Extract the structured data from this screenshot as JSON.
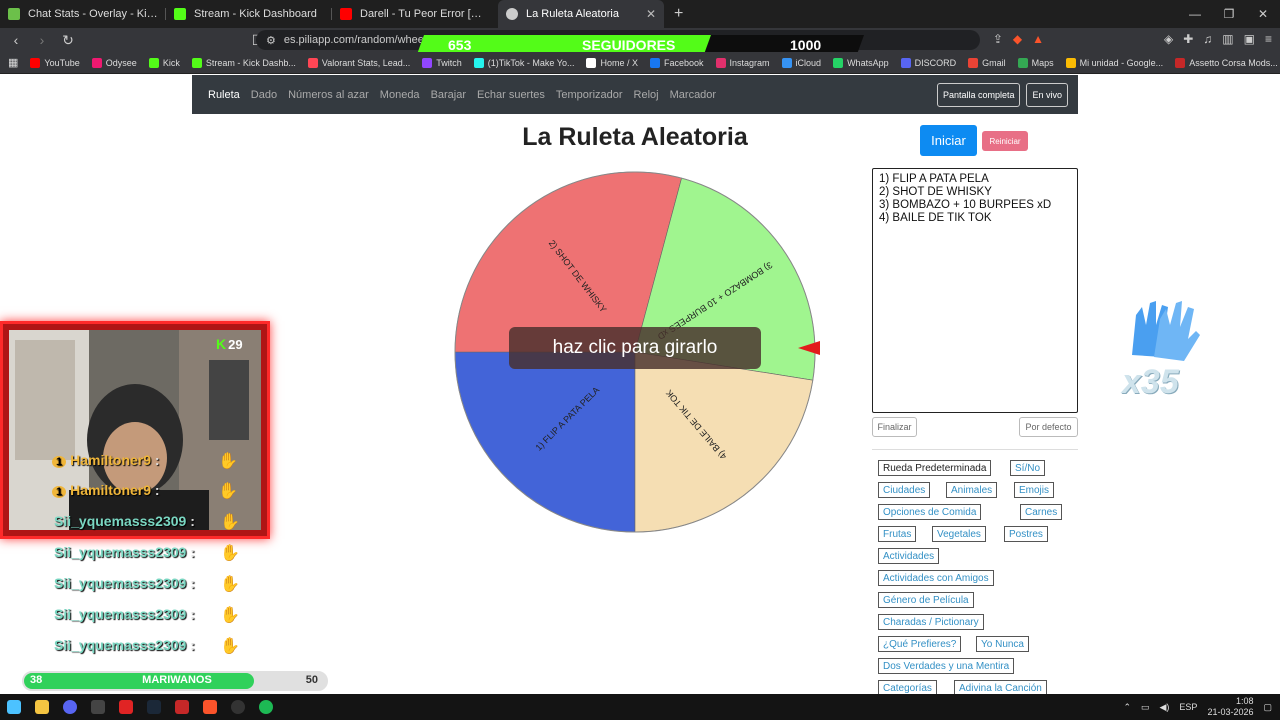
{
  "browser": {
    "tabs": [
      {
        "label": "Chat Stats - Overlay - KickTools",
        "color": "#6cc04a"
      },
      {
        "label": "Stream - Kick Dashboard",
        "color": "#53fc18"
      },
      {
        "label": "Darell - Tu Peor Error [Official Video]",
        "color": "#ff0000"
      },
      {
        "label": "La Ruleta Aleatoria",
        "color": "#cccccc"
      }
    ],
    "url": "es.piliapp.com/random/wheel/",
    "bookmarks": [
      {
        "label": "YouTube",
        "color": "#ff0000"
      },
      {
        "label": "Odysee",
        "color": "#ef1970"
      },
      {
        "label": "Kick",
        "color": "#53fc18"
      },
      {
        "label": "Stream - Kick Dashb...",
        "color": "#53fc18"
      },
      {
        "label": "Valorant Stats, Lead...",
        "color": "#ff4655"
      },
      {
        "label": "Twitch",
        "color": "#9146ff"
      },
      {
        "label": "(1)TikTok - Make Yo...",
        "color": "#25f4ee"
      },
      {
        "label": "Home / X",
        "color": "#ffffff"
      },
      {
        "label": "Facebook",
        "color": "#1877f2"
      },
      {
        "label": "Instagram",
        "color": "#e1306c"
      },
      {
        "label": "iCloud",
        "color": "#3693f3"
      },
      {
        "label": "WhatsApp",
        "color": "#25d366"
      },
      {
        "label": "DISCORD",
        "color": "#5865f2"
      },
      {
        "label": "Gmail",
        "color": "#ea4335"
      },
      {
        "label": "Maps",
        "color": "#34a853"
      },
      {
        "label": "Mi unidad - Google...",
        "color": "#fbbc04"
      },
      {
        "label": "Assetto Corsa Mods...",
        "color": "#c62828"
      }
    ]
  },
  "followers": {
    "count": "653",
    "label": "SEGUIDORES",
    "goal": "1000",
    "fraction": 0.653
  },
  "site": {
    "nav": [
      "Ruleta",
      "Dado",
      "Números al azar",
      "Moneda",
      "Barajar",
      "Echar suertes",
      "Temporizador",
      "Reloj",
      "Marcador"
    ],
    "fullscreen": "Pantalla completa",
    "live": "En vivo",
    "title": "La Ruleta Aleatoria",
    "start": "Iniciar",
    "reset": "Reiniciar",
    "spin_hint": "haz clic para girarlo",
    "finish": "Finalizar",
    "default": "Por defecto"
  },
  "wheel": {
    "segments": [
      {
        "label": "1) FLIP A PATA PELA",
        "color": "#4364d8"
      },
      {
        "label": "2) SHOT DE WHISKY",
        "color": "#ee7273"
      },
      {
        "label": "3) BOMBAZO + 10 BURPEES xD",
        "color": "#a0f58f"
      },
      {
        "label": "4) BAILE DE TIK TOK",
        "color": "#f5deb3"
      }
    ]
  },
  "entries": [
    "1) FLIP A PATA PELA",
    "2) SHOT DE WHISKY",
    "3) BOMBAZO + 10 BURPEES xD",
    "4) BAILE DE TIK TOK"
  ],
  "presets": [
    "Rueda Predeterminada",
    "Sí/No",
    "Ciudades",
    "Animales",
    "Emojis",
    "Opciones de Comida",
    "Carnes",
    "Frutas",
    "Vegetales",
    "Postres",
    "Actividades",
    "Actividades con Amigos",
    "Género de Película",
    "Charadas / Pictionary",
    "¿Qué Prefieres?",
    "Yo Nunca",
    "Dos Verdades y una Mentira",
    "Categorías",
    "Adivina la Canción"
  ],
  "stream": {
    "kick_count": "29",
    "chat": [
      {
        "badge": "1",
        "user": "Hamiltoner9",
        "style": "gold"
      },
      {
        "badge": "1",
        "user": "Hamiltoner9",
        "style": "gold"
      },
      {
        "user": "Sii_yquemasss2309",
        "style": "teal"
      },
      {
        "user": "Sii_yquemasss2309",
        "style": "teal"
      },
      {
        "user": "Sii_yquemasss2309",
        "style": "teal"
      },
      {
        "user": "Sii_yquemasss2309",
        "style": "teal"
      },
      {
        "user": "Sii_yquemasss2309",
        "style": "teal"
      }
    ],
    "glove_count": "x35",
    "progress": {
      "min": "38",
      "max": "50",
      "label": "MARIWANOS",
      "fraction": 0.76
    }
  },
  "taskbar": {
    "lang": "ESP",
    "time": "1:08",
    "date": "21-03-2026"
  }
}
